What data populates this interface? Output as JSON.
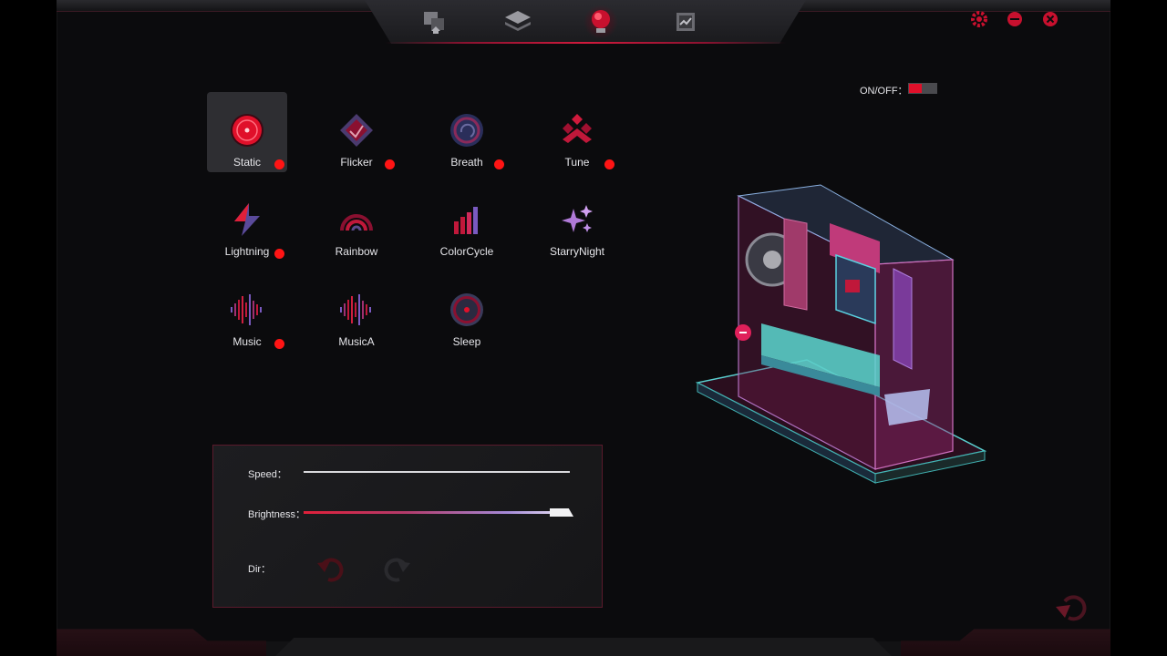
{
  "window": {
    "tabs": [
      {
        "icon": "device-swap-icon"
      },
      {
        "icon": "layers-icon"
      },
      {
        "icon": "lighting-bulb-icon",
        "active": true
      },
      {
        "icon": "monitor-stats-icon"
      }
    ],
    "controls": [
      "settings-icon",
      "minimize-icon",
      "close-icon"
    ]
  },
  "power": {
    "label": "ON/OFF：",
    "on": true
  },
  "effects": [
    {
      "label": "Static",
      "icon": "static-icon",
      "selected": true,
      "has_dot": true
    },
    {
      "label": "Flicker",
      "icon": "flicker-icon",
      "has_dot": true
    },
    {
      "label": "Breath",
      "icon": "breath-icon",
      "has_dot": true
    },
    {
      "label": "Tune",
      "icon": "tune-icon",
      "has_dot": true
    },
    {
      "label": "Lightning",
      "icon": "lightning-icon",
      "has_dot": true
    },
    {
      "label": "Rainbow",
      "icon": "rainbow-icon",
      "has_dot": false
    },
    {
      "label": "ColorCycle",
      "icon": "colorcycle-icon",
      "has_dot": false
    },
    {
      "label": "StarryNight",
      "icon": "starrynight-icon",
      "has_dot": false
    },
    {
      "label": "Music",
      "icon": "music-icon",
      "has_dot": true
    },
    {
      "label": "MusicA",
      "icon": "musica-icon",
      "has_dot": false
    },
    {
      "label": "Sleep",
      "icon": "sleep-icon",
      "has_dot": false
    }
  ],
  "controls": {
    "speed_label": "Speed：",
    "brightness_label": "Brightness：",
    "brightness_value": 0.95,
    "dir_label": "Dir："
  },
  "colors": {
    "accent": "#e0102a",
    "dot": "#ff1414",
    "panel_border": "#5a1a2c",
    "background": "#0b0b0d"
  }
}
